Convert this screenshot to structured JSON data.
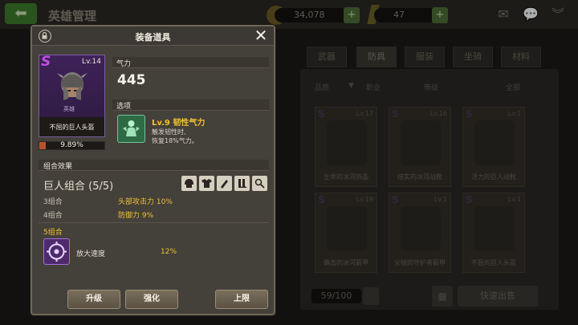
{
  "background": {
    "title": "英雄管理",
    "gold": "34,078",
    "gems": "47",
    "plus_label": "+",
    "tabs": [
      "武器",
      "防具",
      "服装",
      "坐骑",
      "材料"
    ],
    "active_tab": "防具",
    "filters": {
      "quality": "品质",
      "class": "职业",
      "level": "等级",
      "all": "全部"
    },
    "items": [
      {
        "level": "Lv.17",
        "name": "生命的冰河饰品"
      },
      {
        "level": "Lv.16",
        "name": "结实的冰河战靴"
      },
      {
        "level": "Lv.1",
        "name": "活力的巨人战靴"
      },
      {
        "level": "Lv.19",
        "name": "确击的冰河箭甲"
      },
      {
        "level": "Lv.1",
        "name": "尖锐的守护者箭甲"
      },
      {
        "level": "Lv.1",
        "name": "不屈的巨人头盔"
      }
    ],
    "inventory_count": "59/100",
    "sell_label": "快速出售"
  },
  "modal": {
    "title": "装备道具",
    "item": {
      "rank": "S",
      "level": "Lv.14",
      "tag": "英雄",
      "name": "不屈的巨人头盔",
      "progress_text": "9.89%",
      "progress_fraction": 0.0989
    },
    "stat": {
      "label": "气力",
      "value": "445"
    },
    "skill": {
      "label": "选项",
      "name": "Lv.9 韧性气力",
      "desc_line1": "触发韧性时,",
      "desc_line2": "恢复18%气力。"
    },
    "set_bonus": {
      "header": "组合效果",
      "name": "巨人组合 (5/5)",
      "combos": [
        {
          "label": "3组合",
          "bonus": "头部攻击力 10%"
        },
        {
          "label": "4组合",
          "bonus": "防御力 9%"
        }
      ],
      "five_label": "5组合",
      "five_effect_name": "放大速度",
      "five_effect_value": "12%"
    },
    "buttons": {
      "upgrade": "升级",
      "enhance": "强化",
      "limit": "上限"
    }
  },
  "colors": {
    "accent_gold": "#f2c232",
    "rank_purple": "#c34fe6",
    "progress": "#b8522e"
  }
}
